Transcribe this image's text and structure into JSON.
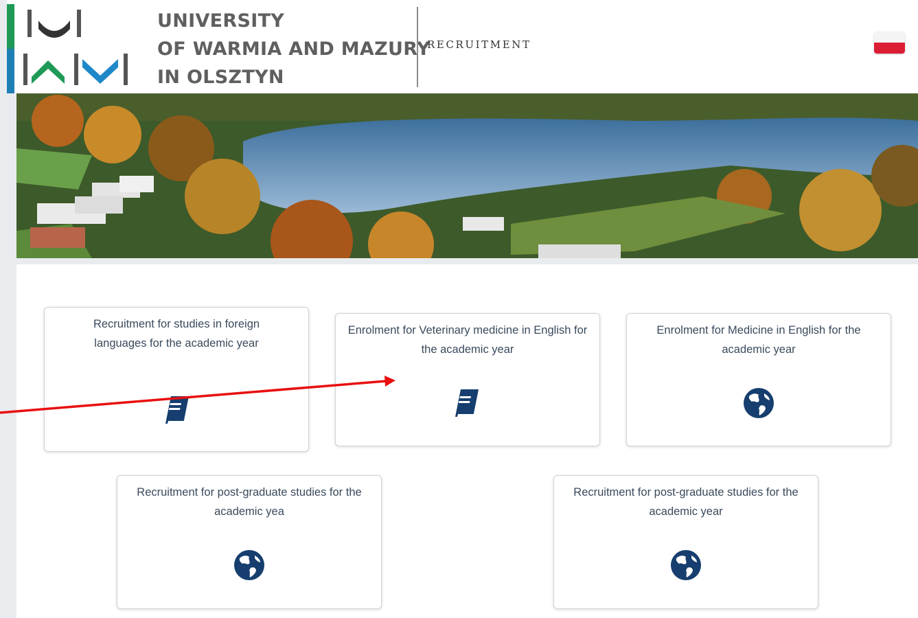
{
  "header": {
    "university_lines": [
      "UNIVERSITY",
      "OF WARMIA AND MAZURY",
      "IN OLSZTYN"
    ],
    "section_label": "RECRUITMENT",
    "language_flag": "poland-flag",
    "colors": {
      "accent_green": "#1e9a56",
      "accent_blue": "#1e7fb5",
      "icon_navy": "#163e6e"
    }
  },
  "banner": {
    "description": "lake-campus-banner"
  },
  "cards": [
    {
      "title": "Recruitment for studies in foreign languages for the academic year",
      "icon": "book-icon"
    },
    {
      "title": "Enrolment for Veterinary medicine in English for the academic year",
      "icon": "book-icon"
    },
    {
      "title": "Enrolment for Medicine in English for the academic year",
      "icon": "globe-icon"
    },
    {
      "title": "Recruitment for post-graduate studies for the academic yea",
      "icon": "globe-icon"
    },
    {
      "title": "Recruitment for post-graduate studies for the academic year",
      "icon": "globe-icon"
    }
  ]
}
